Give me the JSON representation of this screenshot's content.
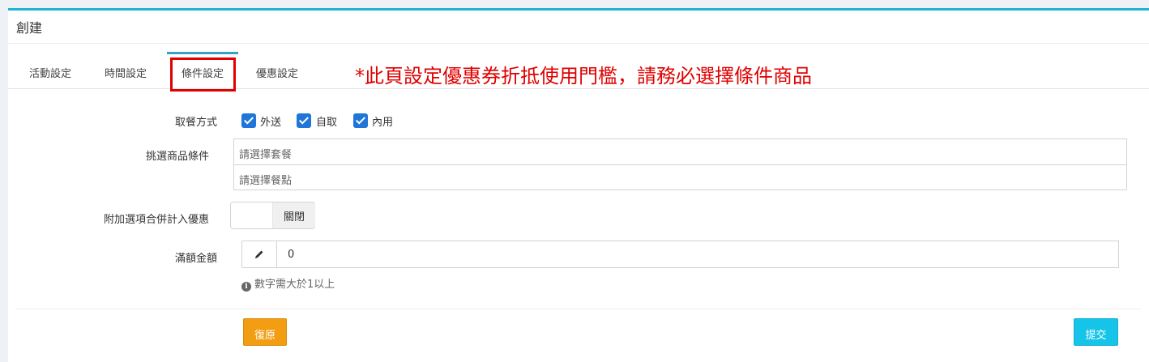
{
  "panel": {
    "title": "創建"
  },
  "tabs": [
    {
      "label": "活動設定",
      "active": false
    },
    {
      "label": "時間設定",
      "active": false
    },
    {
      "label": "條件設定",
      "active": true
    },
    {
      "label": "優惠設定",
      "active": false
    }
  ],
  "notice": "*此頁設定優惠券折抵使用門檻，請務必選擇條件商品",
  "form": {
    "pickup": {
      "label": "取餐方式",
      "options": [
        {
          "label": "外送",
          "checked": true
        },
        {
          "label": "自取",
          "checked": true
        },
        {
          "label": "內用",
          "checked": true
        }
      ]
    },
    "products": {
      "label": "挑選商品條件",
      "combo_placeholder": "請選擇套餐",
      "item_placeholder": "請選擇餐點"
    },
    "addon_discount": {
      "label": "附加選項合併計入優惠",
      "toggle_label": "關閉",
      "enabled": false
    },
    "min_amount": {
      "label": "滿額金額",
      "value": "0",
      "help_icon": "info-icon",
      "help": "數字需大於1以上",
      "addon_icon": "pencil-icon"
    }
  },
  "actions": {
    "reset_label": "復原",
    "submit_label": "提交"
  },
  "colors": {
    "accent": "#1fb5d6",
    "checkbox": "#1f76d8",
    "notice": "#e00000",
    "reset": "#f29d12",
    "submit": "#17c4e9"
  }
}
